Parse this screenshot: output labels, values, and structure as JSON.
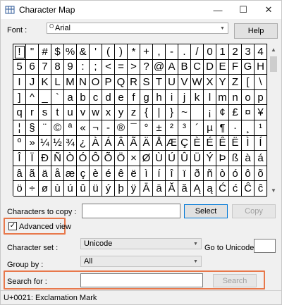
{
  "window": {
    "title": "Character Map",
    "minimize_glyph": "—",
    "maximize_glyph": "☐",
    "close_glyph": "✕"
  },
  "font_row": {
    "label": "Font :",
    "value": "Arial",
    "font_icon_glyph": "O",
    "help_label": "Help"
  },
  "grid": {
    "rows": [
      [
        "!",
        "\"",
        "#",
        "$",
        "%",
        "&",
        "'",
        "(",
        ")",
        "*",
        "+",
        ",",
        "-",
        ".",
        "/",
        "0",
        "1",
        "2",
        "3",
        "4"
      ],
      [
        "5",
        "6",
        "7",
        "8",
        "9",
        ":",
        ";",
        "<",
        "=",
        ">",
        "?",
        "@",
        "A",
        "B",
        "C",
        "D",
        "E",
        "F",
        "G",
        "H"
      ],
      [
        "I",
        "J",
        "K",
        "L",
        "M",
        "N",
        "O",
        "P",
        "Q",
        "R",
        "S",
        "T",
        "U",
        "V",
        "W",
        "X",
        "Y",
        "Z",
        "[",
        "\\"
      ],
      [
        "]",
        "^",
        "_",
        "`",
        "a",
        "b",
        "c",
        "d",
        "e",
        "f",
        "g",
        "h",
        "i",
        "j",
        "k",
        "l",
        "m",
        "n",
        "o",
        "p"
      ],
      [
        "q",
        "r",
        "s",
        "t",
        "u",
        "v",
        "w",
        "x",
        "y",
        "z",
        "{",
        "|",
        "}",
        "~",
        " ",
        "¡",
        "¢",
        "£",
        "¤",
        "¥"
      ],
      [
        "¦",
        "§",
        "¨",
        "©",
        "ª",
        "«",
        "¬",
        "-",
        "®",
        "¯",
        "°",
        "±",
        "²",
        "³",
        "´",
        "µ",
        "¶",
        "·",
        "¸",
        "¹"
      ],
      [
        "º",
        "»",
        "¼",
        "½",
        "¾",
        "¿",
        "À",
        "Á",
        "Â",
        "Ã",
        "Ä",
        "Å",
        "Æ",
        "Ç",
        "È",
        "É",
        "Ê",
        "Ë",
        "Ì",
        "Í"
      ],
      [
        "Î",
        "Ï",
        "Ð",
        "Ñ",
        "Ò",
        "Ó",
        "Ô",
        "Õ",
        "Ö",
        "×",
        "Ø",
        "Ù",
        "Ú",
        "Û",
        "Ü",
        "Ý",
        "Þ",
        "ß",
        "à",
        "á"
      ],
      [
        "â",
        "ã",
        "ä",
        "å",
        "æ",
        "ç",
        "è",
        "é",
        "ê",
        "ë",
        "ì",
        "í",
        "î",
        "ï",
        "ð",
        "ñ",
        "ò",
        "ó",
        "ô",
        "õ"
      ],
      [
        "ö",
        "÷",
        "ø",
        "ù",
        "ú",
        "û",
        "ü",
        "ý",
        "þ",
        "ÿ",
        "Ā",
        "ā",
        "Ă",
        "ă",
        "Ą",
        "ą",
        "Ć",
        "ć",
        "Ĉ",
        "ĉ"
      ]
    ],
    "selected_char": "!"
  },
  "scrollbar": {
    "up_glyph": "▲",
    "down_glyph": "▼"
  },
  "copy_row": {
    "label": "Characters to copy :",
    "value": "",
    "select_label": "Select",
    "copy_label": "Copy"
  },
  "advanced": {
    "label": "Advanced view",
    "checked": true,
    "check_glyph": "✓"
  },
  "charset": {
    "label": "Character set :",
    "value": "Unicode",
    "goto_label": "Go to Unicode :",
    "goto_value": ""
  },
  "groupby": {
    "label": "Group by :",
    "value": "All"
  },
  "search": {
    "label": "Search for :",
    "value": "",
    "button_label": "Search"
  },
  "status": {
    "text": "U+0021: Exclamation Mark"
  },
  "colors": {
    "highlight": "#e8784b",
    "accent": "#0078d7"
  }
}
